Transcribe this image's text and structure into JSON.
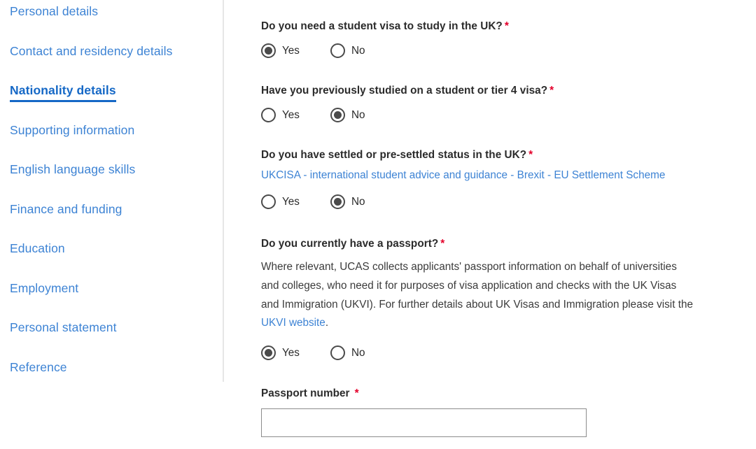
{
  "sidebar": {
    "items": [
      {
        "label": "Personal details",
        "active": false
      },
      {
        "label": "Contact and residency details",
        "active": false
      },
      {
        "label": "Nationality details",
        "active": true
      },
      {
        "label": "Supporting information",
        "active": false
      },
      {
        "label": "English language skills",
        "active": false
      },
      {
        "label": "Finance and funding",
        "active": false
      },
      {
        "label": "Education",
        "active": false
      },
      {
        "label": "Employment",
        "active": false
      },
      {
        "label": "Personal statement",
        "active": false
      },
      {
        "label": "Reference",
        "active": false
      }
    ]
  },
  "form": {
    "required_marker": "*",
    "questions": {
      "student_visa": {
        "label": "Do you need a student visa to study in the UK?",
        "options": {
          "yes": "Yes",
          "no": "No"
        },
        "selected": "Yes"
      },
      "previously_studied": {
        "label": "Have you previously studied on a student or tier 4 visa?",
        "options": {
          "yes": "Yes",
          "no": "No"
        },
        "selected": "No"
      },
      "settled_status": {
        "label": "Do you have settled or pre-settled status in the UK?",
        "helper_link": "UKCISA - international student advice and guidance - Brexit - EU Settlement Scheme",
        "options": {
          "yes": "Yes",
          "no": "No"
        },
        "selected": "No"
      },
      "passport": {
        "label": "Do you currently have a passport?",
        "helper_text_before": "Where relevant, UCAS collects applicants' passport information on behalf of universities and colleges, who need it for purposes of visa application and checks with the UK Visas and Immigration (UKVI). For further details about UK Visas and Immigration please visit the ",
        "helper_link": "UKVI website",
        "helper_text_after": ".",
        "options": {
          "yes": "Yes",
          "no": "No"
        },
        "selected": "Yes"
      },
      "passport_number": {
        "label": "Passport number",
        "value": "",
        "placeholder": ""
      }
    }
  },
  "colors": {
    "link": "#3d83d4",
    "active_nav": "#1568c6",
    "required": "#e4002b",
    "radio": "#4a4a4a",
    "text": "#2b2b2b",
    "divider": "#e6e6e6",
    "input_border": "#8c8c8c"
  }
}
